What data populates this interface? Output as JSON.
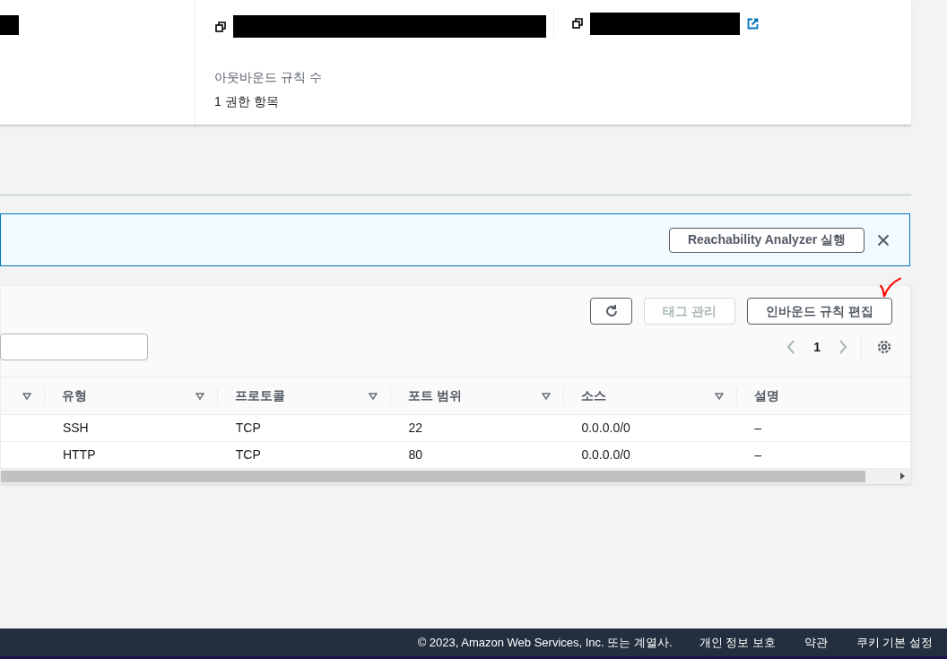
{
  "details": {
    "fields": [
      {
        "label": "아웃바운드 규칙 수",
        "value": "1 권한 항목"
      }
    ]
  },
  "banner": {
    "button": "Reachability Analyzer 실행"
  },
  "toolbar": {
    "buttons": [
      {
        "kind": "refresh",
        "disabled": false
      },
      {
        "kind": "text",
        "label": "태그 관리",
        "disabled": true
      },
      {
        "kind": "text",
        "label": "인바운드 규칙 편집",
        "disabled": false
      }
    ]
  },
  "pagination": {
    "page": "1"
  },
  "table": {
    "columns": [
      "유형",
      "프로토콜",
      "포트 범위",
      "소스",
      "설명"
    ],
    "rows": [
      [
        "SSH",
        "TCP",
        "22",
        "0.0.0.0/0",
        "–"
      ],
      [
        "HTTP",
        "TCP",
        "80",
        "0.0.0.0/0",
        "–"
      ]
    ]
  },
  "footer": {
    "copyright": "© 2023, Amazon Web Services, Inc. 또는 계열사.",
    "links": [
      "개인 정보 보호",
      "약관",
      "쿠키 기본 설정"
    ]
  }
}
